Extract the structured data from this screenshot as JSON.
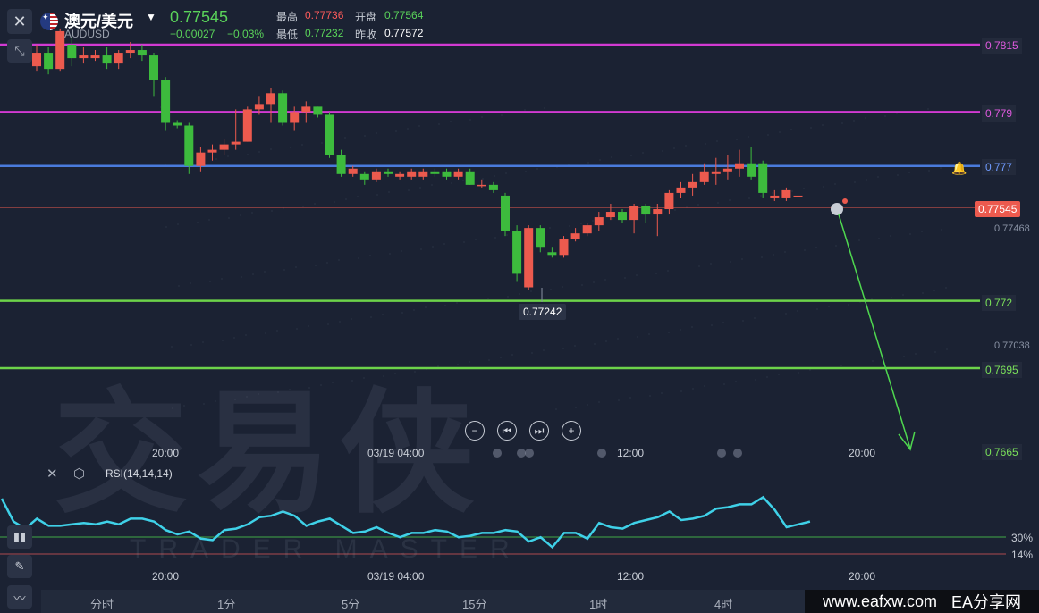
{
  "header": {
    "name": "澳元/美元",
    "code": "AUDUSD",
    "last": "0.77545",
    "change": "−0.00027",
    "change_pct": "−0.03%",
    "high_label": "最高",
    "high": "0.77736",
    "open_label": "开盘",
    "open": "0.77564",
    "low_label": "最低",
    "low": "0.77232",
    "prev_label": "昨收",
    "prev": "0.77572"
  },
  "levels": [
    {
      "price": 0.7815,
      "label": "0.7815",
      "color": "#d23ad2"
    },
    {
      "price": 0.779,
      "label": "0.779",
      "color": "#d23ad2"
    },
    {
      "price": 0.777,
      "label": "0.777",
      "color": "#4a7bdc"
    },
    {
      "price": 0.772,
      "label": "0.772",
      "color": "#6dd34a"
    },
    {
      "price": 0.7695,
      "label": "0.7695",
      "color": "#6dd34a"
    },
    {
      "price": 0.7665,
      "label": "0.7665",
      "color": "#6dd34a"
    }
  ],
  "axis": {
    "current_price": "0.77545",
    "tick_1": "0.77468",
    "tick_2": "0.77038",
    "min_marker": "0.77242"
  },
  "time_labels": [
    "20:00",
    "03/19 04:00",
    "12:00",
    "20:00"
  ],
  "rsi": {
    "label": "RSI(14,14,14)",
    "upper": "30%",
    "lower": "14%",
    "values": [
      52,
      36,
      31,
      38,
      33,
      33,
      34,
      35,
      34,
      36,
      34,
      38,
      38,
      36,
      30,
      27,
      29,
      24,
      23,
      30,
      31,
      34,
      39,
      40,
      43,
      40,
      33,
      36,
      38,
      33,
      28,
      29,
      32,
      28,
      25,
      28,
      28,
      30,
      29,
      25,
      26,
      28,
      28,
      30,
      29,
      22,
      25,
      18,
      28,
      28,
      24,
      35,
      32,
      31,
      35,
      37,
      39,
      43,
      37,
      38,
      40,
      45,
      46,
      48,
      48,
      53,
      44,
      32,
      34,
      36
    ]
  },
  "candles": [
    [
      0.7807,
      0.7812,
      0.7815,
      0.7805
    ],
    [
      0.7812,
      0.7806,
      0.7814,
      0.7804
    ],
    [
      0.7806,
      0.782,
      0.7821,
      0.7805
    ],
    [
      0.7815,
      0.781,
      0.7818,
      0.7807
    ],
    [
      0.781,
      0.7811,
      0.7814,
      0.7808
    ],
    [
      0.781,
      0.7811,
      0.7813,
      0.7809
    ],
    [
      0.7811,
      0.7808,
      0.7814,
      0.7806
    ],
    [
      0.7808,
      0.7812,
      0.7813,
      0.7806
    ],
    [
      0.7812,
      0.7813,
      0.7816,
      0.781
    ],
    [
      0.7813,
      0.7811,
      0.7815,
      0.7809
    ],
    [
      0.7811,
      0.7802,
      0.7812,
      0.7796
    ],
    [
      0.7802,
      0.7786,
      0.7803,
      0.7783
    ],
    [
      0.7786,
      0.7785,
      0.7787,
      0.7784
    ],
    [
      0.7785,
      0.777,
      0.7786,
      0.7767
    ],
    [
      0.777,
      0.7775,
      0.7777,
      0.7768
    ],
    [
      0.7775,
      0.7776,
      0.7778,
      0.7772
    ],
    [
      0.7776,
      0.7778,
      0.778,
      0.7774
    ],
    [
      0.7778,
      0.7779,
      0.7791,
      0.7776
    ],
    [
      0.7779,
      0.7791,
      0.7792,
      0.7779
    ],
    [
      0.7791,
      0.7793,
      0.7796,
      0.7789
    ],
    [
      0.7793,
      0.7797,
      0.7799,
      0.7786
    ],
    [
      0.7797,
      0.7786,
      0.7798,
      0.7785
    ],
    [
      0.7786,
      0.779,
      0.7792,
      0.7783
    ],
    [
      0.779,
      0.7792,
      0.7794,
      0.7786
    ],
    [
      0.7792,
      0.7789,
      0.7792,
      0.7788
    ],
    [
      0.7789,
      0.7774,
      0.779,
      0.7773
    ],
    [
      0.7774,
      0.7767,
      0.7776,
      0.7766
    ],
    [
      0.7767,
      0.7769,
      0.777,
      0.7766
    ],
    [
      0.7767,
      0.7765,
      0.7768,
      0.7763
    ],
    [
      0.7765,
      0.7768,
      0.7769,
      0.7764
    ],
    [
      0.7768,
      0.7767,
      0.7769,
      0.7766
    ],
    [
      0.7766,
      0.7767,
      0.7768,
      0.7765
    ],
    [
      0.7766,
      0.7768,
      0.7769,
      0.7765
    ],
    [
      0.7766,
      0.7768,
      0.7769,
      0.7765
    ],
    [
      0.7768,
      0.7767,
      0.7769,
      0.7766
    ],
    [
      0.7768,
      0.7766,
      0.7769,
      0.7765
    ],
    [
      0.7766,
      0.7768,
      0.7769,
      0.7765
    ],
    [
      0.7768,
      0.7763,
      0.7769,
      0.7763
    ],
    [
      0.7763,
      0.7763,
      0.7765,
      0.7762
    ],
    [
      0.7763,
      0.7761,
      0.7764,
      0.776
    ],
    [
      0.7759,
      0.7746,
      0.776,
      0.7744
    ],
    [
      0.7746,
      0.773,
      0.7748,
      0.7727
    ],
    [
      0.7725,
      0.7747,
      0.7748,
      0.7724
    ],
    [
      0.7747,
      0.774,
      0.7748,
      0.7738
    ],
    [
      0.7738,
      0.7737,
      0.774,
      0.7736
    ],
    [
      0.7737,
      0.7743,
      0.7744,
      0.7736
    ],
    [
      0.7743,
      0.7745,
      0.7747,
      0.7742
    ],
    [
      0.7745,
      0.7748,
      0.7749,
      0.7744
    ],
    [
      0.7748,
      0.7751,
      0.7753,
      0.7746
    ],
    [
      0.7751,
      0.7753,
      0.7756,
      0.775
    ],
    [
      0.7753,
      0.775,
      0.7754,
      0.7749
    ],
    [
      0.775,
      0.7755,
      0.7756,
      0.7745
    ],
    [
      0.7755,
      0.7752,
      0.7756,
      0.7749
    ],
    [
      0.7752,
      0.7754,
      0.7756,
      0.7744
    ],
    [
      0.7754,
      0.776,
      0.7761,
      0.7752
    ],
    [
      0.776,
      0.7762,
      0.7764,
      0.7758
    ],
    [
      0.7762,
      0.7764,
      0.7767,
      0.7759
    ],
    [
      0.7764,
      0.7768,
      0.7771,
      0.7763
    ],
    [
      0.7767,
      0.7768,
      0.7773,
      0.7763
    ],
    [
      0.7768,
      0.7769,
      0.7774,
      0.7765
    ],
    [
      0.7769,
      0.7771,
      0.7776,
      0.7766
    ],
    [
      0.7771,
      0.7766,
      0.7777,
      0.7765
    ],
    [
      0.7771,
      0.776,
      0.7772,
      0.7758
    ],
    [
      0.7758,
      0.7759,
      0.7761,
      0.7757
    ],
    [
      0.7758,
      0.7761,
      0.7762,
      0.7757
    ],
    [
      0.7759,
      0.7759,
      0.776,
      0.7758
    ]
  ],
  "map_dot_note": "",
  "nav": {
    "zoom_out": "−",
    "prev": "⏮",
    "next": "⏭",
    "zoom_in": "+"
  },
  "watermark": {
    "cn": "交易侠",
    "en": "TRADER MASTER"
  },
  "timeframes": [
    "分时",
    "1分",
    "5分",
    "15分",
    "1时",
    "4时"
  ],
  "brand": {
    "site": "www.eafxw.com",
    "name": "EA分享网"
  },
  "colors": {
    "bg": "#1b2233",
    "up": "#ec5a4e",
    "down": "#3dbb3d",
    "rsi": "#3fd1e8"
  }
}
